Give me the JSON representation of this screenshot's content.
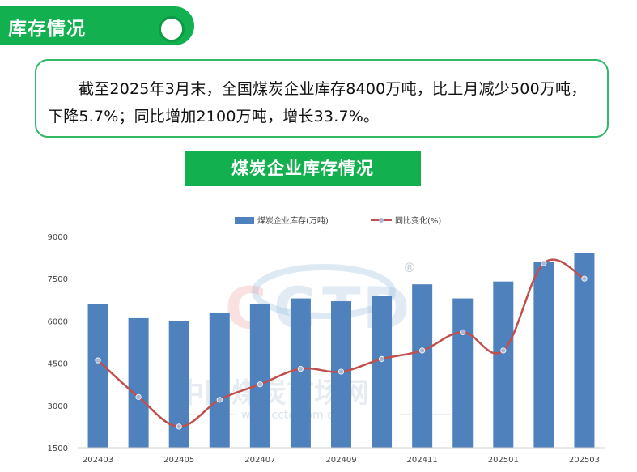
{
  "header": {
    "title": "库存情况"
  },
  "summary": {
    "text": "截至2025年3月末，全国煤炭企业库存8400万吨，比上月减少500万吨，下降5.7%；同比增加2100万吨，增长33.7%。"
  },
  "subtitle": "煤炭企业库存情况",
  "watermark": {
    "brand_c1": "C",
    "brand_c2": "C",
    "brand_t": "T",
    "brand_d": "D",
    "registered": "®",
    "cn_name": "中国煤炭市场网",
    "url": "www.cctd.com.cn"
  },
  "colors": {
    "green": "#12b04f",
    "bar": "#4f81bd",
    "line": "#c0504d",
    "point": "#a9b8d6"
  },
  "chart_data": {
    "type": "bar",
    "categories": [
      "202403",
      "202404",
      "202405",
      "202406",
      "202407",
      "202408",
      "202409",
      "202410",
      "202411",
      "202412",
      "202501",
      "202502",
      "202503"
    ],
    "xtick_labels": [
      "202403",
      "",
      "202405",
      "",
      "202407",
      "",
      "202409",
      "",
      "202411",
      "",
      "202501",
      "",
      "202503"
    ],
    "ylim": [
      1500,
      9000
    ],
    "yticks": [
      "1500",
      "3000",
      "4500",
      "6000",
      "7500",
      "9000"
    ],
    "grid": false,
    "legend_position": "top",
    "series": [
      {
        "name": "煤炭企业库存(万吨)",
        "type": "bar",
        "values": [
          6600,
          6100,
          6000,
          6300,
          6600,
          6800,
          6700,
          6900,
          7300,
          6800,
          7400,
          8100,
          8400
        ]
      },
      {
        "name": "同比变化(%)",
        "type": "line",
        "smooth": true,
        "values": [
          4600,
          3300,
          2250,
          3200,
          3750,
          4300,
          4200,
          4650,
          4950,
          5600,
          4950,
          8050,
          7500
        ]
      }
    ]
  }
}
